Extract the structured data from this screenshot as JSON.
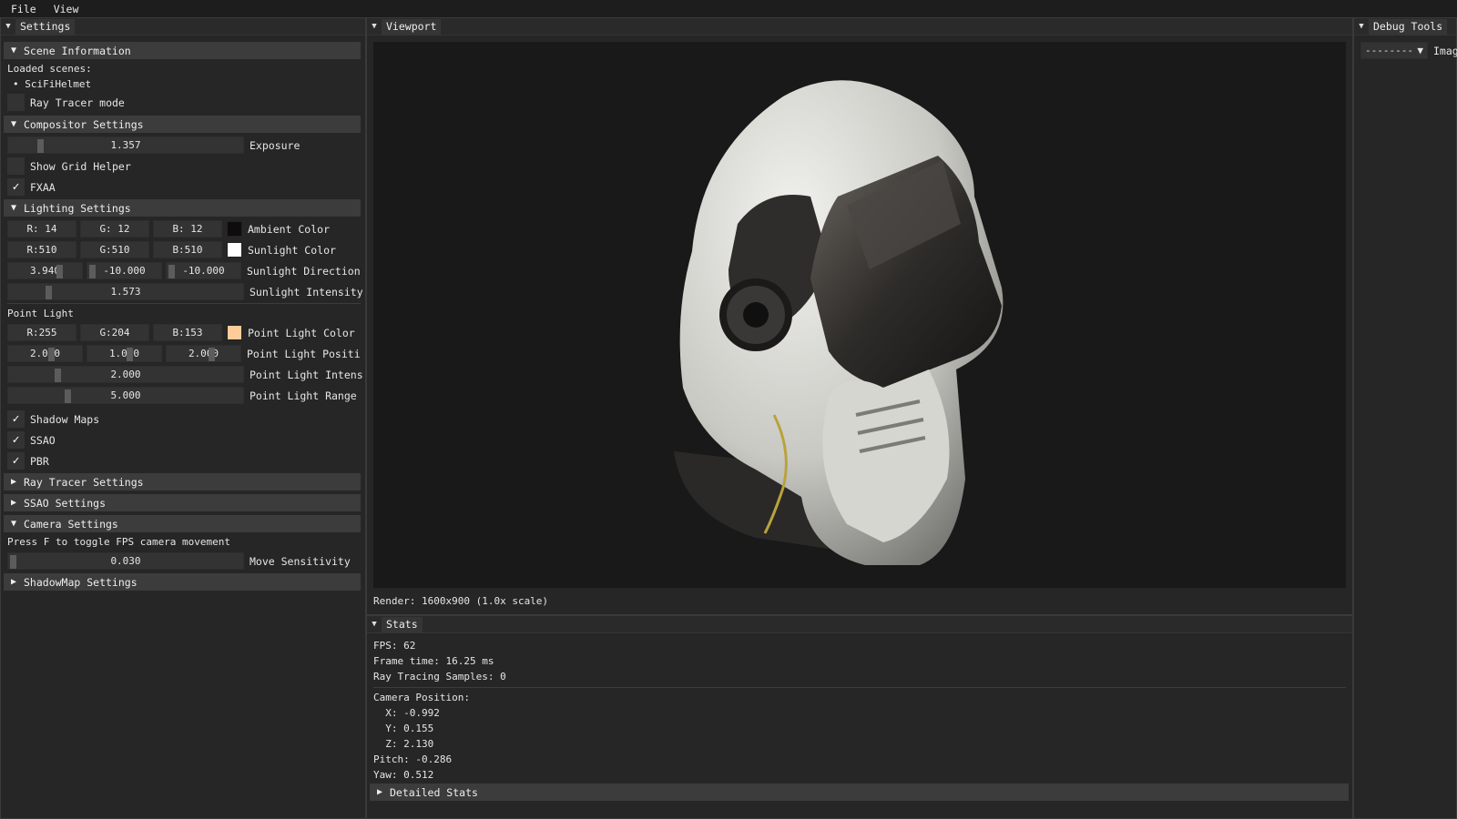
{
  "menu": {
    "file": "File",
    "view": "View"
  },
  "settings": {
    "tab": "Settings",
    "scene_info": {
      "header": "Scene Information",
      "loaded_label": "Loaded scenes:",
      "scene": "SciFiHelmet",
      "ray_tracer_mode": "Ray Tracer mode"
    },
    "compositor": {
      "header": "Compositor Settings",
      "exposure_value": "1.357",
      "exposure_label": "Exposure",
      "exposure_level": 0.145,
      "grid_label": "Show Grid Helper",
      "fxaa_label": "FXAA"
    },
    "lighting": {
      "header": "Lighting Settings",
      "ambient": {
        "r": "R: 14",
        "g": "G: 12",
        "b": "B: 12",
        "label": "Ambient Color",
        "color": "#0e0c0c"
      },
      "sunlight_color": {
        "r": "R:510",
        "g": "G:510",
        "b": "B:510",
        "label": "Sunlight Color",
        "color": "#ffffff"
      },
      "sunlight_direction": {
        "x": "3.940",
        "y": "-10.000",
        "z": "-10.000",
        "label": "Sunlight Direction"
      },
      "sunlight_intensity": {
        "value": "1.573",
        "label": "Sunlight Intensity",
        "level": 0.157
      },
      "point_light_heading": "Point Light",
      "point_color": {
        "r": "R:255",
        "g": "G:204",
        "b": "B:153",
        "label": "Point Light Color",
        "color": "#ffcc99"
      },
      "point_position": {
        "x": "2.000",
        "y": "1.000",
        "z": "2.000",
        "label": "Point Light Positi"
      },
      "point_intensity": {
        "value": "2.000",
        "label": "Point Light Intens",
        "level": 0.2
      },
      "point_range": {
        "value": "5.000",
        "label": "Point Light Range",
        "level": 0.25
      },
      "shadow_maps": "Shadow Maps",
      "ssao": "SSAO",
      "pbr": "PBR"
    },
    "ray_tracer_header": "Ray Tracer Settings",
    "ssao_header": "SSAO Settings",
    "camera": {
      "header": "Camera Settings",
      "hint": "Press F to toggle FPS camera movement",
      "sensitivity_value": "0.030",
      "sensitivity_label": "Move Sensitivity",
      "level": 0.01
    },
    "shadowmap_header": "ShadowMap Settings"
  },
  "viewport": {
    "tab": "Viewport",
    "render_info": "Render: 1600x900 (1.0x scale)"
  },
  "stats": {
    "tab": "Stats",
    "fps": "FPS: 62",
    "frame_time": "Frame time: 16.25 ms",
    "samples": "Ray Tracing Samples: 0",
    "cam_pos": "Camera Position:",
    "x": "  X: -0.992",
    "y": "  Y: 0.155",
    "z": "  Z: 2.130",
    "pitch": "Pitch: -0.286",
    "yaw": "Yaw: 0.512",
    "detailed": "Detailed Stats"
  },
  "debug": {
    "tab": "Debug Tools",
    "combo": "--------",
    "image_label": "Imag"
  }
}
